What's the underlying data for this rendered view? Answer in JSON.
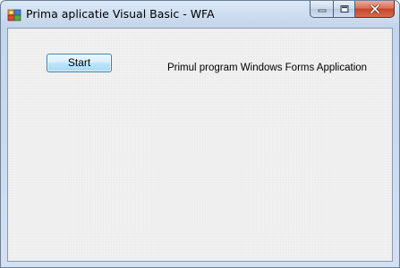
{
  "window": {
    "title": "Prima aplicatie Visual Basic - WFA",
    "icon": "windows-forms-app-icon",
    "caption_buttons": {
      "minimize_icon": "minimize-icon",
      "maximize_icon": "maximize-icon",
      "close_icon": "close-icon"
    }
  },
  "form": {
    "start_button_label": "Start",
    "label_text": "Primul program Windows Forms Application"
  },
  "colors": {
    "titlebar": "#cfdff1",
    "client_background": "#f0f0f0",
    "close_button": "#c7442a",
    "button_border": "#3c7fb1"
  }
}
